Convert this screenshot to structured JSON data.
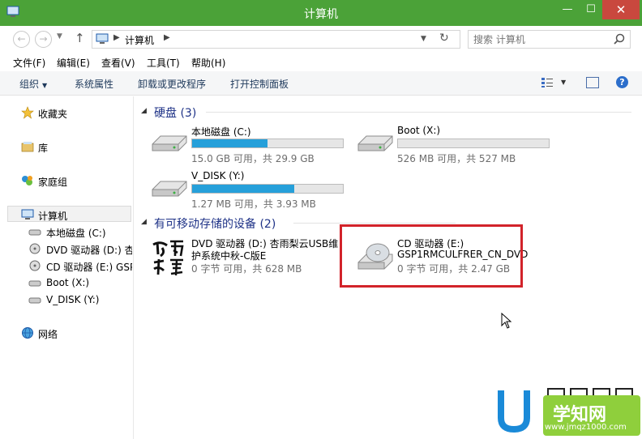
{
  "window": {
    "title": "计算机",
    "min": "—",
    "max": "☐",
    "close": "✕"
  },
  "address": {
    "crumb": "计算机",
    "search_placeholder": "搜索 计算机"
  },
  "menu": [
    "文件(F)",
    "编辑(E)",
    "查看(V)",
    "工具(T)",
    "帮助(H)"
  ],
  "commands": {
    "organize": "组织",
    "system_properties": "系统属性",
    "uninstall": "卸载或更改程序",
    "control_panel": "打开控制面板"
  },
  "nav": {
    "favorites": "收藏夹",
    "library": "库",
    "homegroup": "家庭组",
    "computer": "计算机",
    "drives": [
      "本地磁盘 (C:)",
      "DVD 驱动器 (D:) 杏",
      "CD 驱动器 (E:) GSP",
      "Boot (X:)",
      "V_DISK (Y:)"
    ],
    "network": "网络"
  },
  "groups": {
    "hdd": "硬盘 (3)",
    "removable": "有可移动存储的设备 (2)"
  },
  "hdd": [
    {
      "name": "本地磁盘 (C:)",
      "info": "15.0 GB 可用，共 29.9 GB",
      "used_fraction": 0.5
    },
    {
      "name": "Boot (X:)",
      "info": "526 MB 可用，共 527 MB",
      "used_fraction": 0.0
    },
    {
      "name": "V_DISK (Y:)",
      "info": "1.27 MB 可用，共 3.93 MB",
      "used_fraction": 0.68
    }
  ],
  "removable": [
    {
      "line1": "DVD 驱动器 (D:) 杏雨梨云USB维",
      "line2": "护系统中秋-C版E",
      "info": "0 字节 可用，共 628 MB"
    },
    {
      "line1": "CD 驱动器 (E:)",
      "line2": "GSP1RMCULFRER_CN_DVD",
      "info": "0 字节 可用，共 2.47 GB"
    }
  ],
  "watermark": {
    "brand": "学知网",
    "url": "www.jmqz1000.com"
  },
  "colors": {
    "titlebar": "#4ba238",
    "close": "#c9483e",
    "bar_fill": "#26a0da",
    "highlight": "#d2232a",
    "group_title": "#1e3287"
  }
}
